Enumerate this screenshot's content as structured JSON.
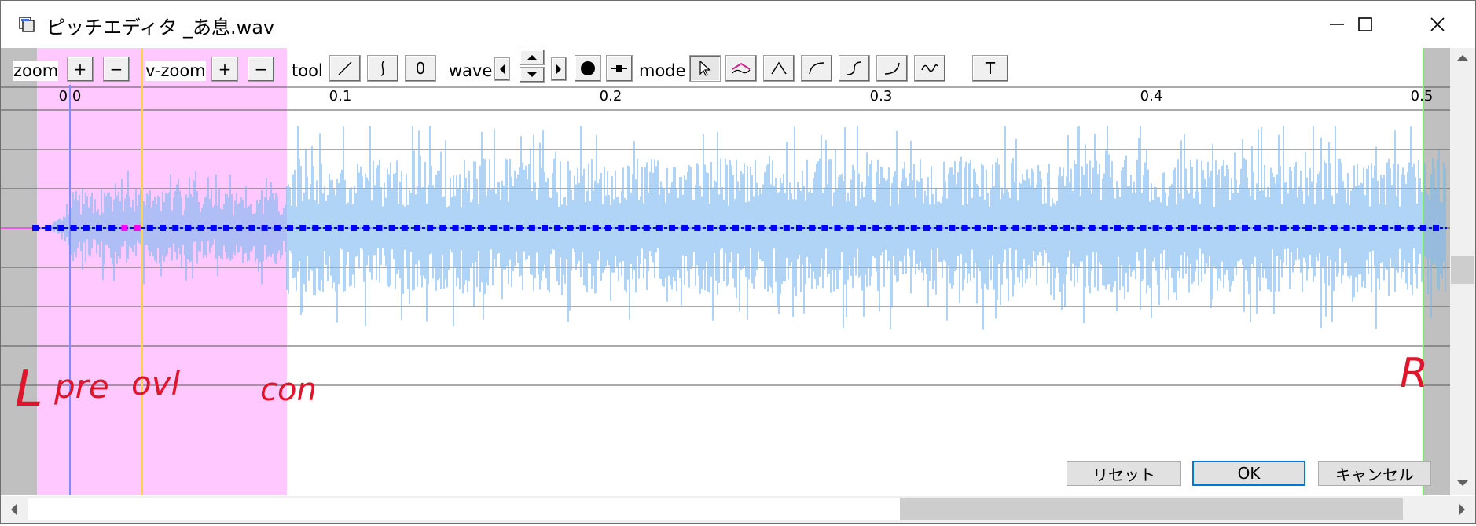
{
  "window": {
    "title": "ピッチエディタ _あ息.wav"
  },
  "toolbar": {
    "zoom_label": "zoom",
    "zoom_plus": "+",
    "zoom_minus": "−",
    "vzoom_label": "v-zoom",
    "vzoom_plus": "+",
    "vzoom_minus": "−",
    "tool_label": "tool",
    "tool_buttons": [
      "line-tool",
      "spline-tool",
      "0"
    ],
    "tool_zero_label": "0",
    "wave_label": "wave",
    "mode_label": "mode",
    "t_label": "T"
  },
  "ruler": {
    "ticks": [
      "0.0",
      "0.1",
      "0.2",
      "0.3",
      "0.4",
      "0.5"
    ]
  },
  "annotations": {
    "left": "L",
    "pre": "pre",
    "ovl": "ovl",
    "con": "con",
    "right": "R"
  },
  "buttons": {
    "reset": "リセット",
    "ok": "OK",
    "cancel": "キャンセル"
  },
  "colors": {
    "overlap_region": "#ffc8ff",
    "waveform": "#7ab8ee",
    "pitch_points": "#0000ff",
    "pitch_selected": "#ff00ff",
    "preutter_line": "#ffd24a",
    "offset_line": "#7f8cff",
    "right_blank_line": "#7bea6a",
    "gray_margin": "#c0c0c0",
    "annotation_ink": "#e0142a"
  }
}
